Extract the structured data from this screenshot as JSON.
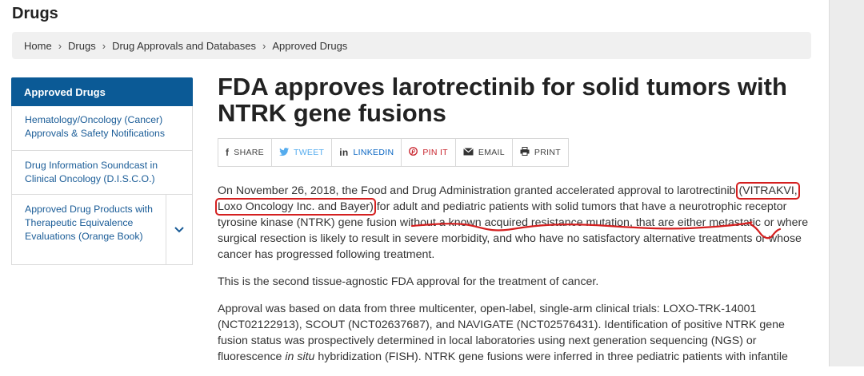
{
  "page": {
    "header": "Drugs"
  },
  "breadcrumb": [
    "Home",
    "Drugs",
    "Drug Approvals and Databases",
    "Approved Drugs"
  ],
  "sidebar": {
    "active": "Approved Drugs",
    "items": [
      {
        "label": "Hematology/Oncology (Cancer) Approvals & Safety Notifications"
      },
      {
        "label": "Drug Information Soundcast in Clinical Oncology (D.I.S.C.O.)"
      },
      {
        "label": "Approved Drug Products with Therapeutic Equivalence Evaluations (Orange Book)"
      }
    ]
  },
  "article": {
    "title": "FDA approves larotrectinib for solid tumors with NTRK gene fusions",
    "share": [
      {
        "icon": "facebook-icon",
        "label": "SHARE"
      },
      {
        "icon": "twitter-icon",
        "label": "TWEET"
      },
      {
        "icon": "linkedin-icon",
        "label": "LINKEDIN"
      },
      {
        "icon": "pinterest-icon",
        "label": "PIN IT"
      },
      {
        "icon": "email-icon",
        "label": "EMAIL"
      },
      {
        "icon": "print-icon",
        "label": "PRINT"
      }
    ],
    "p1_a": "On November 26, 2018, the Food and Drug Administration granted accelerated approval to larotrectinib",
    "p1_highlight": "(VITRAKVI, Loxo Oncology Inc. and Bayer)",
    "p1_b": " for adult and pediatric patients with solid tumors that have a neurotrophic receptor tyrosine kinase (NTRK) gene fusion without a known acquired resistance mutation, that are either metastatic or where surgical resection is likely to result in severe morbidity, and who have no satisfactory alternative treatments or whose cancer has progressed following treatment.",
    "p2": "This is the second tissue-agnostic FDA approval for the treatment of cancer.",
    "p3_a": "Approval was based on data from three multicenter, open-label, single-arm clinical trials: LOXO-TRK-14001 (NCT02122913), SCOUT (NCT02637687), and NAVIGATE (NCT02576431). Identification of positive NTRK gene fusion status was prospectively determined in local laboratories using next generation sequencing (NGS) or fluorescence ",
    "p3_em": "in situ",
    "p3_b": " hybridization (FISH). NTRK gene fusions were inferred in three pediatric patients with infantile"
  },
  "colors": {
    "accent": "#0b5a96",
    "link": "#1a5c97",
    "annotation": "#d42020"
  }
}
